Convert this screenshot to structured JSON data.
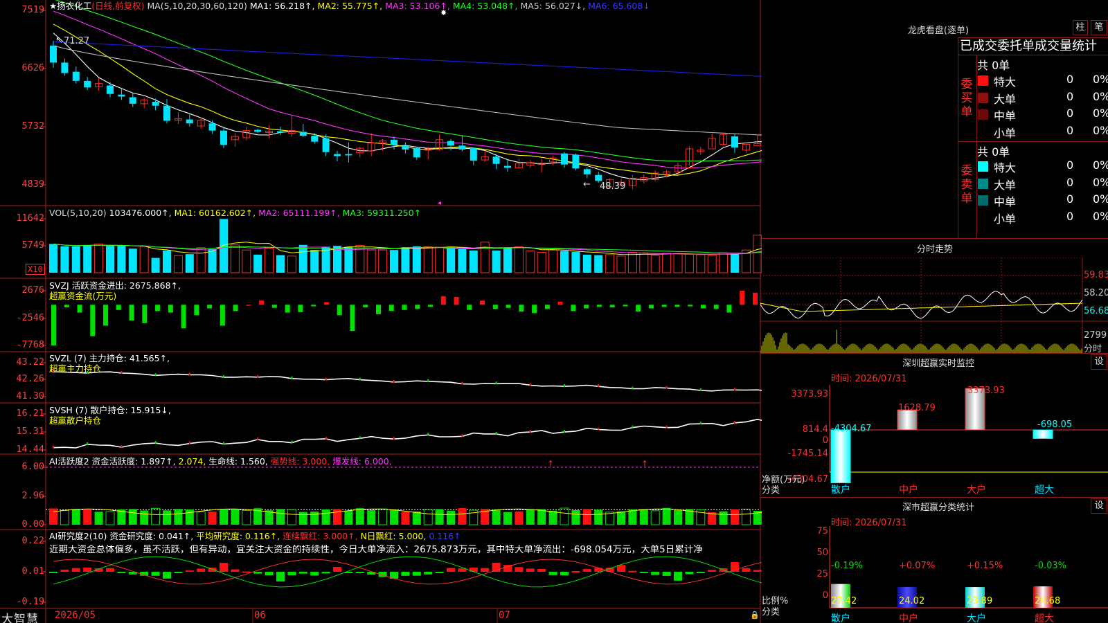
{
  "app": {
    "brand": "大智慧",
    "stock_name": "扬农化工",
    "mode": "(日线,前复权)"
  },
  "colors": {
    "up": "#ff2a2a",
    "down": "#00e5ff",
    "ma1": "#ffffff",
    "ma2": "#ffff00",
    "ma3": "#ff33ff",
    "ma4": "#22ff22",
    "ma5": "#bbbbbb",
    "ma6": "#1e1ee6",
    "grid": "#8b1a1a"
  },
  "main": {
    "header": {
      "params": "MA(5,10,20,30,60,120)",
      "ma1": "MA1: 56.218↑,",
      "ma2": "MA2: 55.775↑,",
      "ma3": "MA3: 53.106↑,",
      "ma4": "MA4: 53.048↑,",
      "ma5": "MA5: 56.027↓,",
      "ma6": "MA6: 65.608↓"
    },
    "y_labels": [
      "7519",
      "6626",
      "5732",
      "4839"
    ],
    "high_label": "71.27",
    "low_label": "48.39"
  },
  "vol": {
    "header": {
      "params": "VOL(5,10,20)",
      "value": "103476.000↑,",
      "ma1": "MA1: 60162.602↑,",
      "ma2": "MA2: 65111.199↑,",
      "ma3": "MA3: 59311.250↑"
    },
    "y_labels": [
      "11642",
      "5749"
    ],
    "unit": "X10"
  },
  "svzj": {
    "header": "SVZJ  活跃资金进出: 2675.868↑,",
    "sub": "超赢资金流(万元)",
    "y_labels": [
      "2676",
      "-2546",
      "-7768"
    ]
  },
  "svzl": {
    "header": "SVZL (7) 主力持仓: 41.565↑,",
    "sub": "超赢主力持仓",
    "y_labels": [
      "43.22",
      "42.26",
      "41.30"
    ]
  },
  "svsh": {
    "header": "SVSH (7) 散户持仓: 15.915↓,",
    "sub": "超赢散户持仓",
    "y_labels": [
      "16.21",
      "15.31",
      "14.44"
    ]
  },
  "ai1": {
    "h1": "AI活跃度2 资金活跃度: 1.897↑,",
    "h2": "2.074,",
    "h3": "生命线: 1.560,",
    "h4": "强势线: 3.000,",
    "h5": "爆发线: 6.000,",
    "y_labels": [
      "6.00",
      "2.96",
      "0.00"
    ]
  },
  "ai2": {
    "h1": "AI研究度2(10) 资金研究度: 0.041↑,",
    "h2": "平均研究度: 0.116↑,",
    "h3": "连续飘红: 3.000↑,",
    "h4": "N日飘红: 5.000,",
    "h5": "0.116↑",
    "text": "近期大资金总体偏多，虽不活跃，但有异动，宜关注大资金的持续性，今日大单净流入：2675.873万元，其中特大单净流出：-698.054万元，大单5日累计净",
    "y_labels": [
      "0.22",
      "0.01",
      "-0.19"
    ]
  },
  "xaxis": {
    "labels": [
      "2026/05",
      "06",
      "07"
    ]
  },
  "dragon": {
    "title": "龙虎看盘(逐单)",
    "btn1": "柱",
    "btn2": "笔",
    "tabs": [
      "已成交委托单成交量统计"
    ],
    "buy": {
      "side": "委买单",
      "total": "共 0单",
      "rows": [
        {
          "label": "特大",
          "count": "0",
          "pct": "0%",
          "color": "#ff1010"
        },
        {
          "label": "大单",
          "count": "0",
          "pct": "0%",
          "color": "#8b1010"
        },
        {
          "label": "中单",
          "count": "0",
          "pct": "0%",
          "color": "#6a0a0a"
        },
        {
          "label": "小单",
          "count": "0",
          "pct": "0%",
          "color": "#000000"
        }
      ]
    },
    "sell": {
      "side": "委卖单",
      "total": "共 0单",
      "rows": [
        {
          "label": "特大",
          "count": "0",
          "pct": "0%",
          "color": "#00ffff"
        },
        {
          "label": "大单",
          "count": "0",
          "pct": "0%",
          "color": "#008b8b"
        },
        {
          "label": "中单",
          "count": "0",
          "pct": "0%",
          "color": "#006a6a"
        },
        {
          "label": "小单",
          "count": "0",
          "pct": "0%",
          "color": "#000000"
        }
      ]
    }
  },
  "intraday": {
    "title": "分时走势",
    "y_labels": [
      "59.83",
      "58.20",
      "56.68"
    ],
    "vol_label": "2799",
    "vol_unit": "分时"
  },
  "monitor": {
    "title": "深圳超赢实时监控",
    "settings": "设",
    "time": "时间: 2026/07/31",
    "y_labels": [
      "3373.93",
      "814.4",
      "0",
      "-1745.14",
      "-4304.67"
    ],
    "net_label": "净额(万元)",
    "cat_label": "分类",
    "categories": [
      "散户",
      "中户",
      "大户",
      "超大"
    ],
    "values": [
      -4304.67,
      1628.79,
      3373.93,
      -698.05
    ],
    "value_labels": [
      "-4304.67",
      "1628.79",
      "3373.93",
      "-698.05"
    ]
  },
  "classify": {
    "title": "深市超赢分类统计",
    "settings": "设",
    "time": "时间: 2026/07/31",
    "y_labels": [
      "75",
      "50",
      "25",
      "0"
    ],
    "ratio_label": "比例%",
    "cat_label": "分类",
    "categories": [
      "散户",
      "中户",
      "大户",
      "超大"
    ],
    "values": [
      27.42,
      24.02,
      23.89,
      24.68
    ],
    "changes": [
      "-0.19%",
      "+0.07%",
      "+0.15%",
      "-0.03%"
    ]
  },
  "chart_data": {
    "type": "candlestick",
    "title": "扬农化工(日线,前复权)",
    "ylim": [
      48.39,
      71.27
    ],
    "series": [
      {
        "name": "OHLC",
        "values": [
          [
            69.8,
            70.5,
            66.4,
            67.2
          ],
          [
            67.2,
            67.8,
            65.2,
            65.6
          ],
          [
            65.8,
            66.6,
            64.0,
            64.4
          ],
          [
            64.4,
            65.0,
            63.0,
            63.4
          ],
          [
            63.5,
            64.8,
            62.9,
            64.0
          ],
          [
            63.7,
            64.2,
            61.9,
            62.4
          ],
          [
            62.3,
            63.2,
            61.5,
            62.0
          ],
          [
            61.9,
            62.5,
            60.4,
            60.9
          ],
          [
            60.9,
            61.8,
            60.2,
            61.5
          ],
          [
            61.2,
            61.7,
            59.9,
            60.6
          ],
          [
            60.6,
            61.6,
            57.9,
            58.3
          ],
          [
            58.4,
            59.6,
            57.8,
            58.6
          ],
          [
            58.5,
            59.4,
            57.4,
            57.9
          ],
          [
            57.5,
            58.8,
            57.1,
            58.4
          ],
          [
            57.9,
            58.4,
            56.3,
            56.8
          ],
          [
            56.8,
            57.4,
            54.1,
            54.6
          ],
          [
            55.4,
            56.4,
            54.3,
            55.9
          ],
          [
            55.7,
            57.4,
            55.3,
            56.8
          ],
          [
            56.9,
            57.1,
            56.4,
            56.6
          ],
          [
            56.5,
            57.6,
            55.6,
            56.7
          ],
          [
            56.7,
            57.4,
            56.1,
            56.5
          ],
          [
            56.4,
            59.2,
            55.9,
            56.8
          ],
          [
            56.6,
            57.8,
            55.8,
            56.0
          ],
          [
            56.0,
            56.4,
            54.8,
            55.1
          ],
          [
            55.6,
            56.2,
            52.9,
            53.5
          ],
          [
            53.2,
            53.7,
            52.1,
            52.9
          ],
          [
            53.2,
            55.0,
            51.9,
            53.0
          ],
          [
            53.4,
            54.3,
            52.7,
            54.1
          ],
          [
            53.7,
            56.4,
            52.9,
            54.9
          ],
          [
            54.9,
            55.5,
            53.7,
            55.2
          ],
          [
            55.4,
            55.9,
            53.9,
            54.6
          ],
          [
            54.5,
            55.0,
            53.3,
            53.9
          ],
          [
            54.1,
            54.3,
            52.3,
            52.7
          ],
          [
            53.8,
            54.3,
            52.4,
            54.0
          ],
          [
            53.9,
            56.2,
            53.7,
            55.4
          ],
          [
            55.2,
            55.5,
            53.8,
            54.5
          ],
          [
            54.5,
            56.1,
            53.6,
            53.9
          ],
          [
            54.1,
            54.2,
            51.5,
            52.2
          ],
          [
            52.3,
            53.7,
            52.0,
            52.8
          ],
          [
            52.8,
            53.2,
            50.9,
            51.7
          ],
          [
            51.4,
            52.4,
            50.5,
            51.1
          ],
          [
            51.1,
            52.5,
            51.0,
            51.8
          ],
          [
            51.5,
            52.3,
            51.1,
            51.9
          ],
          [
            51.6,
            52.5,
            50.4,
            51.8
          ],
          [
            52.0,
            52.9,
            51.5,
            52.6
          ],
          [
            53.3,
            53.5,
            51.1,
            51.6
          ],
          [
            53.1,
            53.3,
            50.7,
            51.0
          ],
          [
            50.9,
            51.2,
            49.5,
            50.1
          ],
          [
            50.0,
            50.5,
            48.8,
            49.1
          ],
          [
            48.2,
            49.5,
            48.3,
            49.3
          ],
          [
            48.5,
            49.4,
            48.3,
            48.9
          ],
          [
            48.4,
            50.0,
            47.8,
            49.5
          ],
          [
            49.1,
            50.1,
            48.7,
            49.6
          ],
          [
            49.3,
            50.7,
            49.0,
            50.3
          ],
          [
            50.1,
            50.8,
            49.6,
            50.5
          ],
          [
            50.5,
            51.9,
            50.0,
            51.4
          ],
          [
            51.1,
            54.4,
            51.4,
            54.0
          ],
          [
            53.6,
            54.3,
            53.1,
            53.8
          ],
          [
            54.0,
            56.3,
            54.2,
            55.6
          ],
          [
            54.7,
            56.5,
            54.5,
            56.2
          ],
          [
            55.9,
            56.3,
            53.4,
            54.2
          ],
          [
            53.8,
            54.6,
            53.4,
            54.7
          ],
          [
            54.5,
            56.2,
            54.7,
            54.8
          ],
          [
            55.0,
            55.8,
            54.7,
            55.6
          ],
          [
            55.0,
            55.9,
            54.7,
            56.1
          ],
          [
            55.4,
            58.0,
            55.2,
            57.4
          ],
          [
            57.0,
            57.3,
            55.4,
            56.6
          ]
        ]
      },
      {
        "name": "VOL",
        "values": [
          6.2,
          5.7,
          5.7,
          6.0,
          6.2,
          5.8,
          5.8,
          5.2,
          5.7,
          3.2,
          4.8,
          3.7,
          4.0,
          5.4,
          5.1,
          11.6,
          6.0,
          4.9,
          3.9,
          5.3,
          3.8,
          3.6,
          6.0,
          4.9,
          5.6,
          5.8,
          5.6,
          5.9,
          4.9,
          4.9,
          4.9,
          5.5,
          5.7,
          5.6,
          5.5,
          5.6,
          5.1,
          4.8,
          6.6,
          4.8,
          5.3,
          5.6,
          4.7,
          4.4,
          4.9,
          4.7,
          4.5,
          3.9,
          3.8,
          3.9,
          3.6,
          4.4,
          4.3,
          3.7,
          4.2,
          4.1,
          4.0,
          3.9,
          3.8,
          4.3,
          4.0,
          4.9,
          8.1,
          6.0,
          5.0,
          3.9,
          4.1,
          4.8,
          4.8,
          3.7
        ]
      },
      {
        "name": "SVZJ",
        "values": [
          -7768,
          -500,
          -1500,
          -6000,
          -4000,
          -1000,
          -3000,
          -3500,
          -1200,
          -1500,
          -4500,
          -2000,
          -700,
          -4000,
          -1200,
          0,
          800,
          -600,
          -1500,
          -1400,
          -300,
          500,
          -2000,
          -5000,
          -500,
          -1800,
          -1200,
          -1000,
          -800,
          -400,
          1600,
          1500,
          -1000,
          800,
          -800,
          -600,
          -1300,
          -1600,
          -800,
          600,
          -1200,
          -700,
          -400,
          -500,
          -300,
          -1300,
          -700,
          -400,
          -400,
          -300,
          -700,
          -800,
          -1500,
          2676,
          2300
        ]
      }
    ]
  }
}
